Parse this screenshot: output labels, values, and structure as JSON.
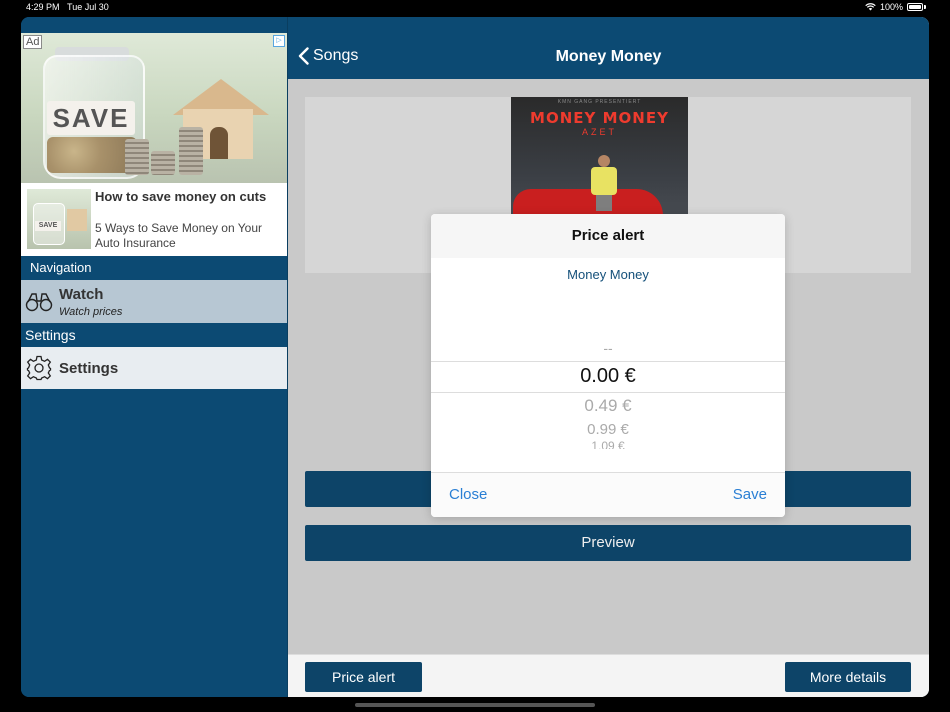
{
  "status": {
    "time": "4:29 PM",
    "date": "Tue Jul 30",
    "battery": "100%"
  },
  "ad": {
    "badge": "Ad",
    "image_text": "SAVE",
    "headline": "How to save money on cuts",
    "body": "5 Ways to Save Money on Your Auto Insurance"
  },
  "sidebar": {
    "navigation_header": "Navigation",
    "watch": {
      "title": "Watch",
      "subtitle": "Watch prices"
    },
    "settings_header": "Settings",
    "settings_item": {
      "title": "Settings"
    }
  },
  "main": {
    "back_label": "Songs",
    "title": "Money Money",
    "cover": {
      "title": "MONEY MONEY",
      "artist": "AZET",
      "label": "KMN GANG PRESENTIERT"
    },
    "preview_label": "Preview",
    "hidden_button_label": "",
    "bottom": {
      "price_alert": "Price alert",
      "more_details": "More details"
    }
  },
  "dialog": {
    "title": "Price alert",
    "item": "Money Money",
    "picker": {
      "above": "--",
      "selected": "0.00 €",
      "below": [
        "0.49 €",
        "0.99 €",
        "1.09 €"
      ]
    },
    "close": "Close",
    "save": "Save"
  },
  "colors": {
    "brand": "#0c4a73",
    "link": "#2a7fd4"
  }
}
